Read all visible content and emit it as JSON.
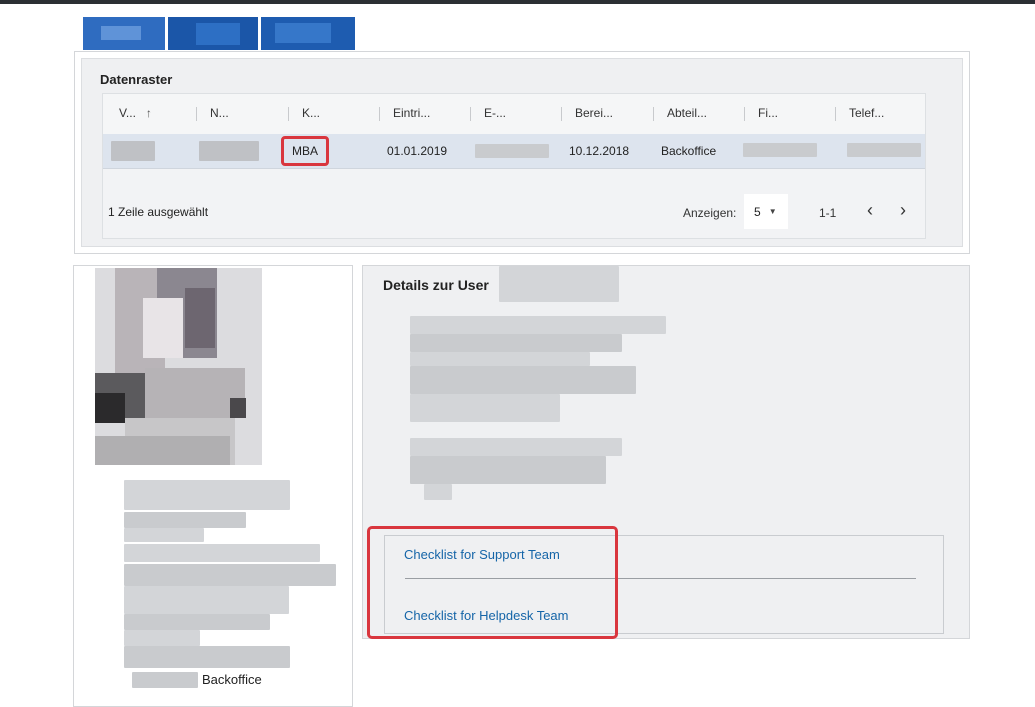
{
  "grid": {
    "title": "Datenraster",
    "columns": [
      "V...",
      "N...",
      "K...",
      "Eintri...",
      "E-...",
      "Berei...",
      "Abteil...",
      "Fi...",
      "Telef..."
    ],
    "sort_icon": "arrow-up-icon",
    "row": {
      "kuerzel": "MBA",
      "eintritt": "01.01.2019",
      "bereich": "10.12.2018",
      "abteilung": "Backoffice"
    },
    "selection_status": "1 Zeile ausgewählt",
    "show_label": "Anzeigen:",
    "page_size": "5",
    "range": "1-1",
    "prev_icon": "chevron-left-icon",
    "next_icon": "chevron-right-icon"
  },
  "profile": {
    "department": "Backoffice"
  },
  "details": {
    "title": "Details zur User",
    "checklists": [
      "Checklist for Support Team",
      "Checklist for Helpdesk Team"
    ]
  },
  "colors": {
    "highlight": "#d9363e",
    "link": "#1565a8",
    "selected_row": "#dde4ee",
    "brand": "#1b56a8"
  }
}
